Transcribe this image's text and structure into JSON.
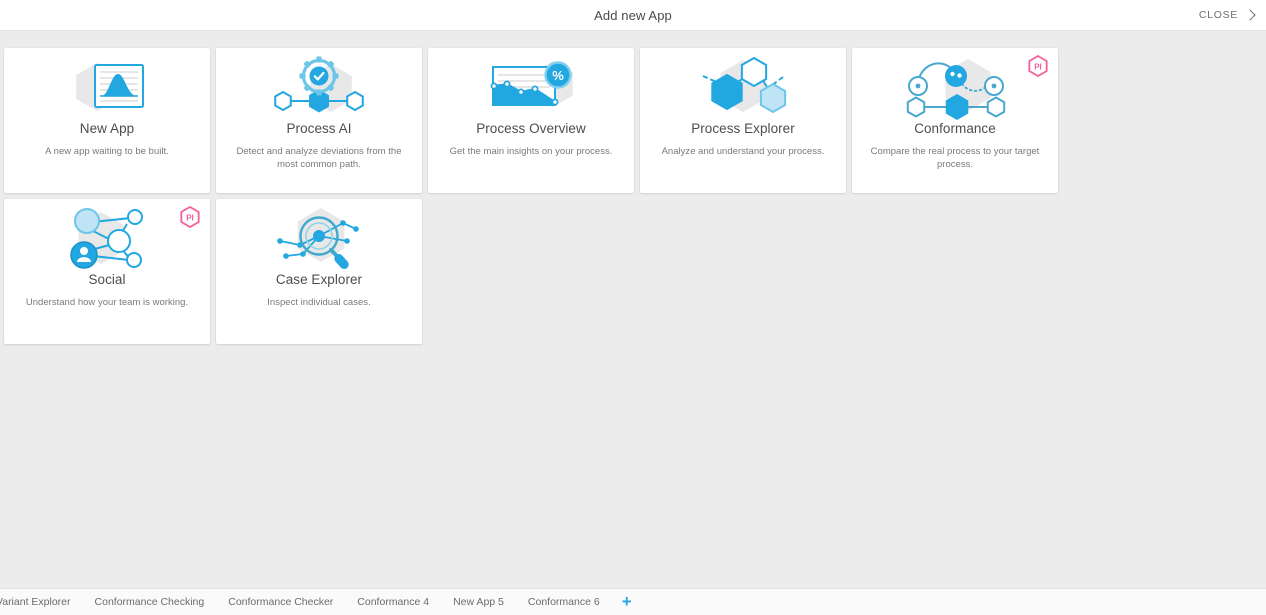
{
  "header": {
    "title": "Add new App",
    "close_label": "CLOSE",
    "close_icon": "chevron-right-icon"
  },
  "colors": {
    "accent_blue": "#23a7e0",
    "light_blue": "#bfe4f5",
    "badge_pink": "#f45f9a",
    "page_bg": "#ececec",
    "card_bg": "#ffffff",
    "title_text": "#4d4d4d",
    "desc_text": "#7a7a7a"
  },
  "cards": [
    {
      "title": "New App",
      "description": "A new app waiting to be built.",
      "icon": "chart-document-icon",
      "badge": null
    },
    {
      "title": "Process AI",
      "description": "Detect and analyze deviations from the most common path.",
      "icon": "gear-check-flow-icon",
      "badge": null
    },
    {
      "title": "Process Overview",
      "description": "Get the main insights on your process.",
      "icon": "area-chart-percent-icon",
      "badge": null
    },
    {
      "title": "Process Explorer",
      "description": "Analyze and understand your process.",
      "icon": "hexagon-network-icon",
      "badge": null
    },
    {
      "title": "Conformance",
      "description": "Compare the real process to your target process.",
      "icon": "conformance-flow-icon",
      "badge": "PI"
    },
    {
      "title": "Social",
      "description": "Understand how your team is working.",
      "icon": "social-network-icon",
      "badge": "PI"
    },
    {
      "title": "Case Explorer",
      "description": "Inspect individual cases.",
      "icon": "magnifier-network-icon",
      "badge": null
    }
  ],
  "tabbar": {
    "tabs": [
      {
        "label": "Variant Explorer"
      },
      {
        "label": "Conformance Checking"
      },
      {
        "label": "Conformance Checker"
      },
      {
        "label": "Conformance 4"
      },
      {
        "label": "New App 5"
      },
      {
        "label": "Conformance 6"
      }
    ],
    "add_label": "+"
  }
}
